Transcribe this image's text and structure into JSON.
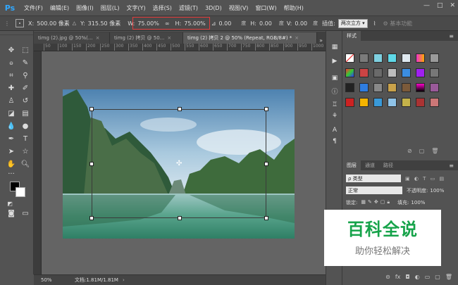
{
  "app": {
    "logo": "Ps"
  },
  "menu": [
    "文件(F)",
    "编辑(E)",
    "图像(I)",
    "图层(L)",
    "文字(Y)",
    "选择(S)",
    "滤镜(T)",
    "3D(D)",
    "视图(V)",
    "窗口(W)",
    "帮助(H)"
  ],
  "window_controls": [
    "—",
    "□",
    "✕"
  ],
  "options": {
    "x_label": "X:",
    "x_value": "500.00 像素",
    "y_label": "Y:",
    "y_value": "315.50 像素",
    "w_label": "W:",
    "w_value": "75.00%",
    "link_icon": "∞",
    "h_label": "H:",
    "h_value": "75.00%",
    "angle_value": "0.00",
    "angle_unit": "度",
    "h_skew_label": "H:",
    "h_skew_value": "0.00",
    "h_skew_unit": "度",
    "v_skew_label": "V:",
    "v_skew_value": "0.00",
    "v_skew_unit": "度",
    "interp_label": "插值:",
    "interp_value": "两次立方",
    "workspace": "基本功能"
  },
  "tabs": [
    {
      "label": "timg (2).jpg @ 50%(...",
      "close": "×"
    },
    {
      "label": "timg (2) 拷贝 @ 50...",
      "close": "×"
    },
    {
      "label": "timg (2) 拷贝 2 @ 50% (Repeat, RGB/8#) *",
      "close": "×"
    }
  ],
  "tabs_more": "»",
  "ruler_ticks": [
    "50",
    "100",
    "150",
    "200",
    "250",
    "300",
    "350",
    "400",
    "450",
    "500",
    "550",
    "600",
    "650",
    "700",
    "750",
    "800",
    "850",
    "900",
    "950",
    "1000",
    "1050"
  ],
  "status": {
    "zoom": "50%",
    "doc": "文档:1.81M/1.81M",
    "arrow": "›"
  },
  "styles_panel": {
    "tab": "样式",
    "menu_icon": "≡"
  },
  "layers_panel": {
    "tabs": [
      "图层",
      "通道",
      "路径"
    ],
    "kind_label": "ρ 类型",
    "blend_mode": "正常",
    "opacity_label": "不透明度:",
    "opacity_value": "100%",
    "lock_label": "锁定:",
    "fill_label": "填充:",
    "fill_value": "100%"
  },
  "watermark": {
    "title": "百科全说",
    "subtitle": "助你轻松解决"
  },
  "colors": {
    "fg": "#000000",
    "bg": "#ffffff",
    "highlight": "#e23b3b",
    "watermark": "#16a34a"
  }
}
